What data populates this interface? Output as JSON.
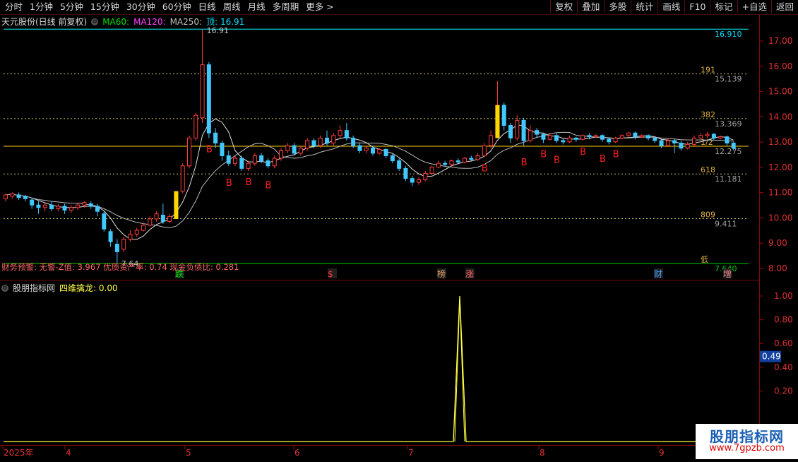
{
  "toolbar": {
    "periods": [
      "分时",
      "1分钟",
      "5分钟",
      "15分钟",
      "30分钟",
      "60分钟",
      "日线",
      "周线",
      "月线",
      "多周期",
      "更多 >"
    ],
    "actions": [
      "复权",
      "叠加",
      "多股",
      "统计",
      "画线",
      "F10",
      "标记",
      "+自选",
      "返回"
    ]
  },
  "header": {
    "stock_name": "天元股份(日线 前复权)",
    "ma60": "MA60:",
    "ma120": "MA120:",
    "ma250": "MA250:",
    "top_label": "顶: 16.91",
    "colors": {
      "ma60": "#00e000",
      "ma120": "#ff40ff",
      "ma250": "#c0c0c0",
      "top": "#00e0ff"
    }
  },
  "finance_line": "财务预警: 无警-Z值: 3.967 优质资产率: 0.74 现金负债比: 0.281",
  "sub_header": {
    "name": "股朋指标网",
    "indicator": "四维擒龙: 0.00"
  },
  "price_axis": [
    "17.00",
    "16.00",
    "15.00",
    "14.00",
    "13.00",
    "12.00",
    "11.00",
    "10.00",
    "9.00",
    "8.00"
  ],
  "sub_axis": [
    "1.00",
    "0.80",
    "0.60",
    "0.40",
    "0.20"
  ],
  "sub_current": "0.49",
  "date_axis": [
    "2025年",
    "4",
    "5",
    "6",
    "7",
    "8",
    "9"
  ],
  "fib_levels": [
    {
      "label": "",
      "value": "16.910"
    },
    {
      "label": "191",
      "value": "15.139"
    },
    {
      "label": "382",
      "value": "13.369"
    },
    {
      "label": "1/2",
      "value": "12.275"
    },
    {
      "label": "618",
      "value": "11.181"
    },
    {
      "label": "809",
      "value": "9.411"
    },
    {
      "label": "低",
      "value": "7.640"
    }
  ],
  "chart_labels": {
    "high_mark": "16.91",
    "low_mark": "7.64",
    "buy_mark": "B",
    "events": [
      "跌",
      "$",
      "榜",
      "涨",
      "财",
      "增"
    ]
  },
  "watermark": {
    "title": "股朋指标网",
    "url": "www.7gpzb.com"
  },
  "chart_data": {
    "type": "candlestick",
    "price_range": [
      7.3,
      17.3
    ],
    "candles": [
      [
        10.2,
        10.35,
        10.1,
        10.4
      ],
      [
        10.3,
        10.4,
        10.2,
        10.45
      ],
      [
        10.35,
        10.25,
        10.15,
        10.45
      ],
      [
        10.3,
        10.2,
        10.1,
        10.35
      ],
      [
        10.15,
        9.95,
        9.8,
        10.25
      ],
      [
        9.95,
        9.85,
        9.6,
        10.1
      ],
      [
        9.85,
        9.95,
        9.7,
        10.05
      ],
      [
        9.95,
        9.8,
        9.7,
        10.1
      ],
      [
        9.8,
        9.9,
        9.7,
        10.0
      ],
      [
        9.9,
        9.75,
        9.6,
        10.0
      ],
      [
        9.75,
        9.85,
        9.65,
        9.95
      ],
      [
        9.85,
        9.95,
        9.75,
        10.05
      ],
      [
        9.95,
        10.05,
        9.85,
        10.1
      ],
      [
        10.0,
        9.9,
        9.8,
        10.1
      ],
      [
        9.9,
        9.7,
        9.5,
        10.0
      ],
      [
        9.6,
        9.0,
        8.9,
        9.7
      ],
      [
        8.9,
        8.5,
        8.3,
        9.0
      ],
      [
        8.4,
        8.1,
        7.64,
        8.6
      ],
      [
        8.2,
        8.6,
        8.1,
        8.7
      ],
      [
        8.6,
        8.8,
        8.5,
        8.95
      ],
      [
        8.8,
        8.95,
        8.7,
        9.05
      ],
      [
        8.95,
        9.15,
        8.9,
        9.25
      ],
      [
        9.15,
        9.4,
        9.1,
        9.5
      ],
      [
        9.4,
        9.6,
        9.3,
        9.7
      ],
      [
        9.55,
        9.3,
        9.2,
        10.0
      ],
      [
        9.3,
        9.5,
        9.25,
        9.6
      ],
      [
        9.5,
        10.45,
        9.4,
        10.5
      ],
      [
        10.5,
        11.5,
        10.4,
        11.6
      ],
      [
        11.5,
        12.6,
        11.4,
        12.7
      ],
      [
        12.6,
        13.5,
        12.5,
        13.6
      ],
      [
        13.4,
        15.5,
        13.2,
        16.91
      ],
      [
        15.5,
        12.8,
        12.6,
        15.6
      ],
      [
        12.8,
        12.4,
        12.2,
        13.0
      ],
      [
        12.4,
        11.9,
        11.7,
        12.5
      ],
      [
        11.9,
        11.6,
        11.5,
        12.1
      ],
      [
        11.6,
        11.8,
        11.5,
        11.9
      ],
      [
        11.8,
        11.4,
        11.3,
        11.9
      ],
      [
        11.4,
        11.6,
        11.3,
        11.7
      ],
      [
        11.6,
        11.9,
        11.5,
        12.0
      ],
      [
        11.9,
        11.7,
        11.6,
        12.0
      ],
      [
        11.7,
        11.5,
        11.4,
        11.8
      ],
      [
        11.5,
        11.8,
        11.4,
        11.9
      ],
      [
        11.8,
        12.1,
        11.7,
        12.2
      ],
      [
        12.1,
        12.3,
        12.0,
        12.4
      ],
      [
        12.3,
        12.0,
        11.9,
        12.4
      ],
      [
        12.0,
        12.2,
        11.9,
        12.3
      ],
      [
        12.2,
        12.5,
        12.1,
        12.6
      ],
      [
        12.5,
        12.3,
        12.2,
        12.6
      ],
      [
        12.3,
        12.6,
        12.2,
        12.7
      ],
      [
        12.6,
        12.4,
        12.3,
        12.9
      ],
      [
        12.4,
        12.7,
        12.3,
        12.8
      ],
      [
        12.7,
        12.9,
        12.6,
        13.1
      ],
      [
        12.9,
        12.6,
        12.5,
        13.2
      ],
      [
        12.6,
        12.3,
        12.2,
        12.7
      ],
      [
        12.3,
        12.1,
        12.0,
        12.4
      ],
      [
        12.1,
        12.2,
        12.0,
        12.3
      ],
      [
        12.2,
        12.0,
        11.9,
        12.3
      ],
      [
        12.0,
        12.15,
        11.95,
        12.2
      ],
      [
        12.15,
        11.9,
        11.8,
        12.2
      ],
      [
        11.9,
        11.7,
        11.6,
        12.0
      ],
      [
        11.7,
        11.4,
        11.3,
        11.8
      ],
      [
        11.4,
        11.0,
        10.9,
        11.5
      ],
      [
        11.0,
        10.85,
        10.7,
        11.1
      ],
      [
        10.85,
        10.95,
        10.75,
        11.05
      ],
      [
        10.95,
        11.2,
        10.9,
        11.3
      ],
      [
        11.2,
        11.45,
        11.15,
        11.5
      ],
      [
        11.45,
        11.6,
        11.4,
        11.7
      ],
      [
        11.6,
        11.55,
        11.45,
        11.7
      ],
      [
        11.55,
        11.7,
        11.5,
        11.75
      ],
      [
        11.7,
        11.65,
        11.6,
        11.8
      ],
      [
        11.65,
        11.8,
        11.6,
        11.85
      ],
      [
        11.8,
        11.75,
        11.7,
        11.9
      ],
      [
        11.75,
        11.9,
        11.7,
        12.0
      ],
      [
        11.9,
        12.3,
        11.85,
        12.4
      ],
      [
        12.3,
        12.7,
        12.2,
        12.9
      ],
      [
        12.7,
        13.9,
        12.6,
        14.85
      ],
      [
        13.9,
        13.1,
        12.9,
        14.0
      ],
      [
        13.1,
        12.6,
        12.4,
        13.2
      ],
      [
        12.6,
        13.3,
        12.5,
        13.5
      ],
      [
        13.3,
        12.5,
        12.3,
        13.4
      ],
      [
        12.5,
        12.9,
        12.4,
        13.1
      ],
      [
        12.9,
        12.75,
        12.6,
        13.0
      ],
      [
        12.75,
        12.55,
        12.4,
        12.8
      ],
      [
        12.55,
        12.7,
        12.5,
        12.8
      ],
      [
        12.7,
        12.5,
        12.4,
        12.8
      ],
      [
        12.5,
        12.45,
        12.35,
        12.6
      ],
      [
        12.45,
        12.6,
        12.4,
        12.7
      ],
      [
        12.6,
        12.55,
        12.45,
        12.65
      ],
      [
        12.55,
        12.7,
        12.5,
        12.75
      ],
      [
        12.7,
        12.65,
        12.55,
        12.8
      ],
      [
        12.65,
        12.7,
        12.6,
        12.75
      ],
      [
        12.7,
        12.55,
        12.45,
        12.75
      ],
      [
        12.55,
        12.45,
        12.35,
        12.6
      ],
      [
        12.45,
        12.6,
        12.4,
        12.65
      ],
      [
        12.6,
        12.7,
        12.55,
        12.75
      ],
      [
        12.7,
        12.8,
        12.65,
        12.85
      ],
      [
        12.8,
        12.65,
        12.55,
        12.85
      ],
      [
        12.65,
        12.7,
        12.6,
        12.75
      ],
      [
        12.7,
        12.6,
        12.5,
        12.75
      ],
      [
        12.6,
        12.5,
        12.4,
        12.65
      ],
      [
        12.5,
        12.3,
        12.2,
        12.55
      ],
      [
        12.3,
        12.5,
        12.25,
        12.6
      ],
      [
        12.5,
        12.4,
        12.0,
        12.55
      ],
      [
        12.4,
        12.2,
        12.1,
        12.5
      ],
      [
        12.2,
        12.35,
        12.15,
        12.45
      ],
      [
        12.35,
        12.6,
        12.3,
        12.7
      ],
      [
        12.6,
        12.7,
        12.55,
        12.8
      ],
      [
        12.7,
        12.75,
        12.6,
        12.85
      ],
      [
        12.75,
        12.6,
        12.5,
        12.8
      ],
      [
        12.6,
        12.65,
        12.55,
        12.7
      ],
      [
        12.65,
        12.4,
        12.3,
        12.7
      ],
      [
        12.4,
        12.2,
        12.1,
        12.45
      ]
    ],
    "ma_lines": [
      "MA60",
      "MA120",
      "MA250"
    ],
    "indicator": {
      "name": "四维擒龙",
      "ylim": [
        0,
        1.1
      ],
      "spike_value": 1.0,
      "current": 0.0
    }
  }
}
